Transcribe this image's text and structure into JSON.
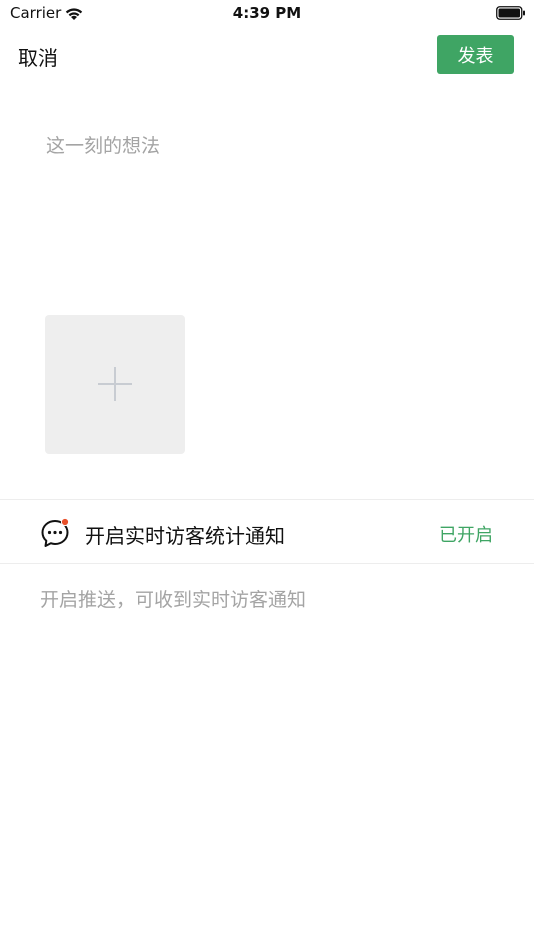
{
  "status_bar": {
    "carrier": "Carrier",
    "time": "4:39 PM"
  },
  "nav": {
    "cancel_label": "取消",
    "publish_label": "发表"
  },
  "compose": {
    "placeholder": "这一刻的想法"
  },
  "notification": {
    "label": "开启实时访客统计通知",
    "status": "已开启",
    "hint": "开启推送，可收到实时访客通知"
  },
  "colors": {
    "accent": "#3fa564",
    "badge": "#e8502a",
    "tile_bg": "#eeeeee",
    "placeholder": "#a4a4a4"
  }
}
